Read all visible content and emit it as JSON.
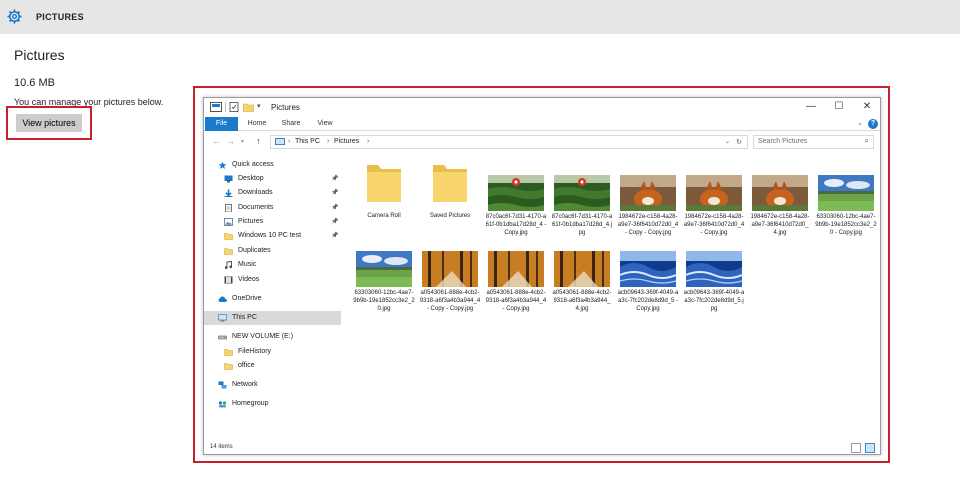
{
  "settings": {
    "header_title": "PICTURES",
    "page_title": "Pictures",
    "size": "10.6 MB",
    "description": "You can manage your pictures below.",
    "view_button": "View pictures"
  },
  "explorer": {
    "title": "Pictures",
    "ribbon_tabs": [
      "File",
      "Home",
      "Share",
      "View"
    ],
    "address": [
      "This PC",
      "Pictures"
    ],
    "search_placeholder": "Search Pictures",
    "status": "14 items",
    "nav": [
      {
        "label": "Quick access",
        "icon": "star-icon",
        "pinned": false
      },
      {
        "label": "Desktop",
        "icon": "desktop-icon",
        "pinned": true
      },
      {
        "label": "Downloads",
        "icon": "download-icon",
        "pinned": true
      },
      {
        "label": "Documents",
        "icon": "documents-icon",
        "pinned": true
      },
      {
        "label": "Pictures",
        "icon": "pictures-icon",
        "pinned": true
      },
      {
        "label": "Windows 10 PC test",
        "icon": "folder-icon",
        "pinned": true
      },
      {
        "label": "Duplicates",
        "icon": "folder-icon",
        "pinned": false
      },
      {
        "label": "Music",
        "icon": "music-icon",
        "pinned": false
      },
      {
        "label": "Videos",
        "icon": "videos-icon",
        "pinned": false
      },
      {
        "label": "OneDrive",
        "icon": "cloud-icon",
        "pinned": false
      },
      {
        "label": "This PC",
        "icon": "computer-icon",
        "pinned": false,
        "selected": true
      },
      {
        "label": "NEW VOLUME (E:)",
        "icon": "drive-icon",
        "pinned": false
      },
      {
        "label": "FileHistory",
        "icon": "folder-icon",
        "pinned": false
      },
      {
        "label": "office",
        "icon": "folder-icon",
        "pinned": false
      },
      {
        "label": "Network",
        "icon": "network-icon",
        "pinned": false
      },
      {
        "label": "Homegroup",
        "icon": "homegroup-icon",
        "pinned": false
      }
    ],
    "files": [
      {
        "name": "Camera Roll",
        "kind": "folder"
      },
      {
        "name": "Saved Pictures",
        "kind": "folder"
      },
      {
        "name": "87c0ac6f-7d31-4170-a61f-0b1dba17d28d_4 - Copy.jpg",
        "kind": "tea"
      },
      {
        "name": "87c0ac6f-7d31-4170-a61f-0b1dba17d28d_4.jpg",
        "kind": "tea"
      },
      {
        "name": "1984672e-c158-4a28-a9e7-36f6410d72d0_4 - Copy - Copy.jpg",
        "kind": "fox"
      },
      {
        "name": "1984672e-c158-4a28-a9e7-36f6410d72d0_4 - Copy.jpg",
        "kind": "fox"
      },
      {
        "name": "1984672e-c158-4a28-a9e7-36f6410d72d0_4.jpg",
        "kind": "fox"
      },
      {
        "name": "63303060-12bc-4ae7-9b9b-19e1852cc3e2_20 - Copy.jpg",
        "kind": "field"
      },
      {
        "name": "63303060-12bc-4ae7-9b9b-19e1852cc3e2_20.jpg",
        "kind": "field"
      },
      {
        "name": "a0543061-888e-4cb2-9318-a6f3a4b3a944_4 - Copy - Copy.jpg",
        "kind": "forest"
      },
      {
        "name": "a0543061-888e-4cb2-9318-a6f3a4b3a944_4 - Copy.jpg",
        "kind": "forest"
      },
      {
        "name": "a0543061-888e-4cb2-9318-a6f3a4b3a944_4.jpg",
        "kind": "forest"
      },
      {
        "name": "acb09643-369f-4049-aa3c-7fc202de8d9d_5 - Copy.jpg",
        "kind": "wave"
      },
      {
        "name": "acb09643-369f-4049-aa3c-7fc202de8d9d_5.jpg",
        "kind": "wave"
      }
    ]
  },
  "colors": {
    "accent": "#1979ca",
    "highlight_frame": "#c8202a",
    "folder": "#f7d46c"
  }
}
